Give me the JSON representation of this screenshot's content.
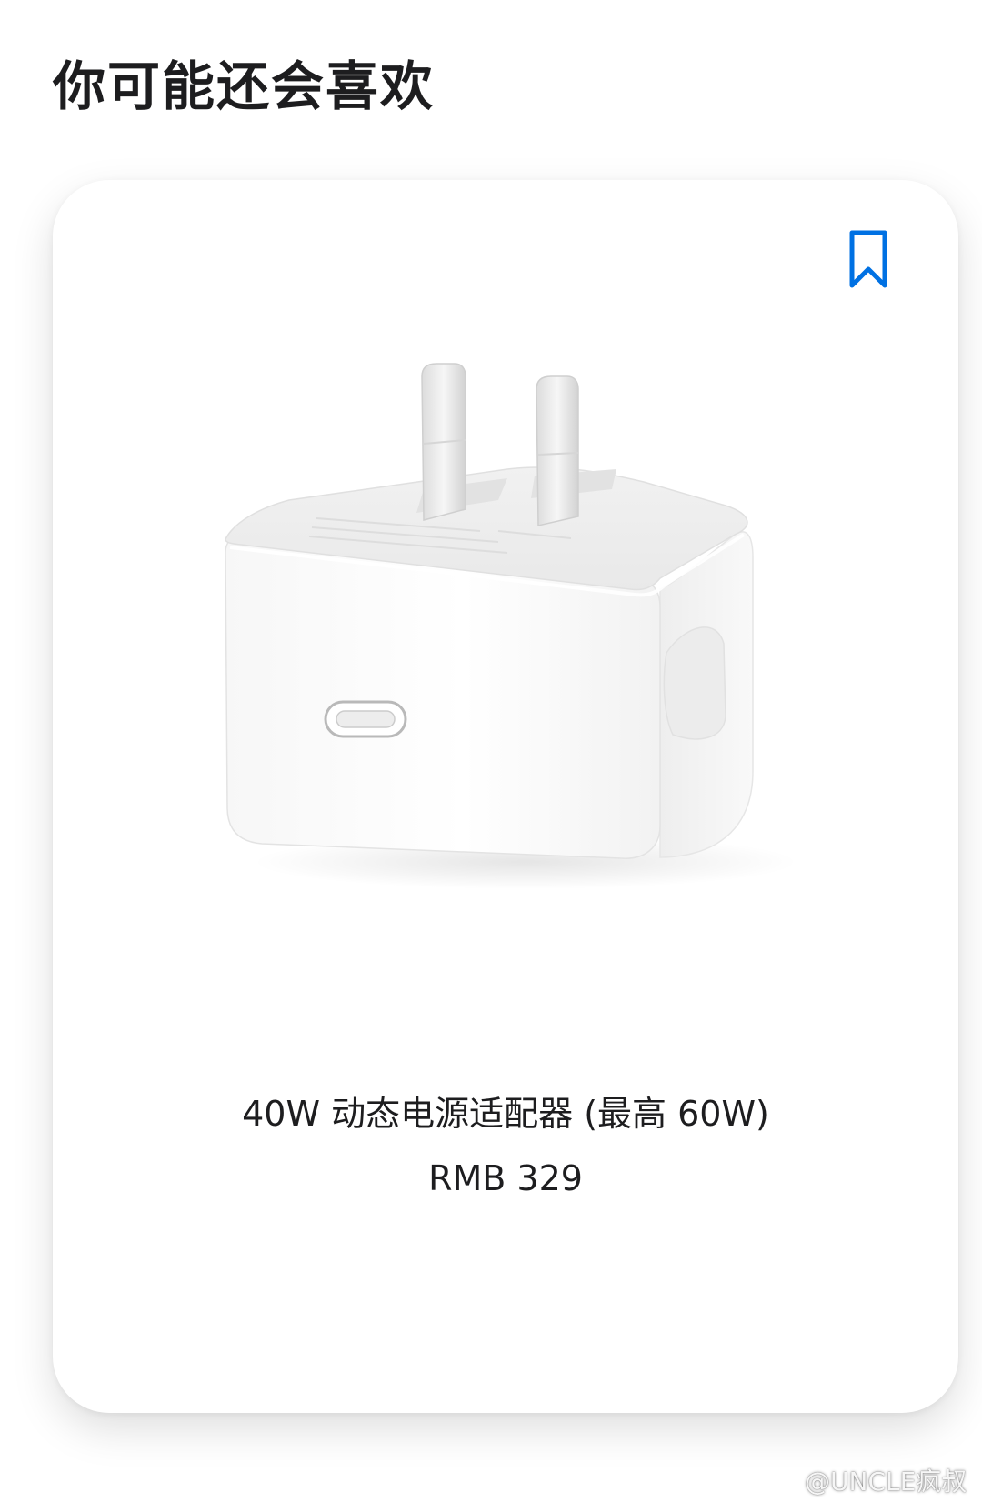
{
  "section": {
    "title": "你可能还会喜欢"
  },
  "product": {
    "name": "40W 动态电源适配器 (最高 60W)",
    "price": "RMB 329",
    "image_icon": "power-adapter-icon",
    "bookmark_icon": "bookmark-icon"
  },
  "watermark": {
    "text": "@UNCLE疯叔",
    "icon": "weibo-icon"
  },
  "colors": {
    "accent": "#0071e3",
    "text": "#1d1d1f",
    "background": "#ffffff"
  }
}
